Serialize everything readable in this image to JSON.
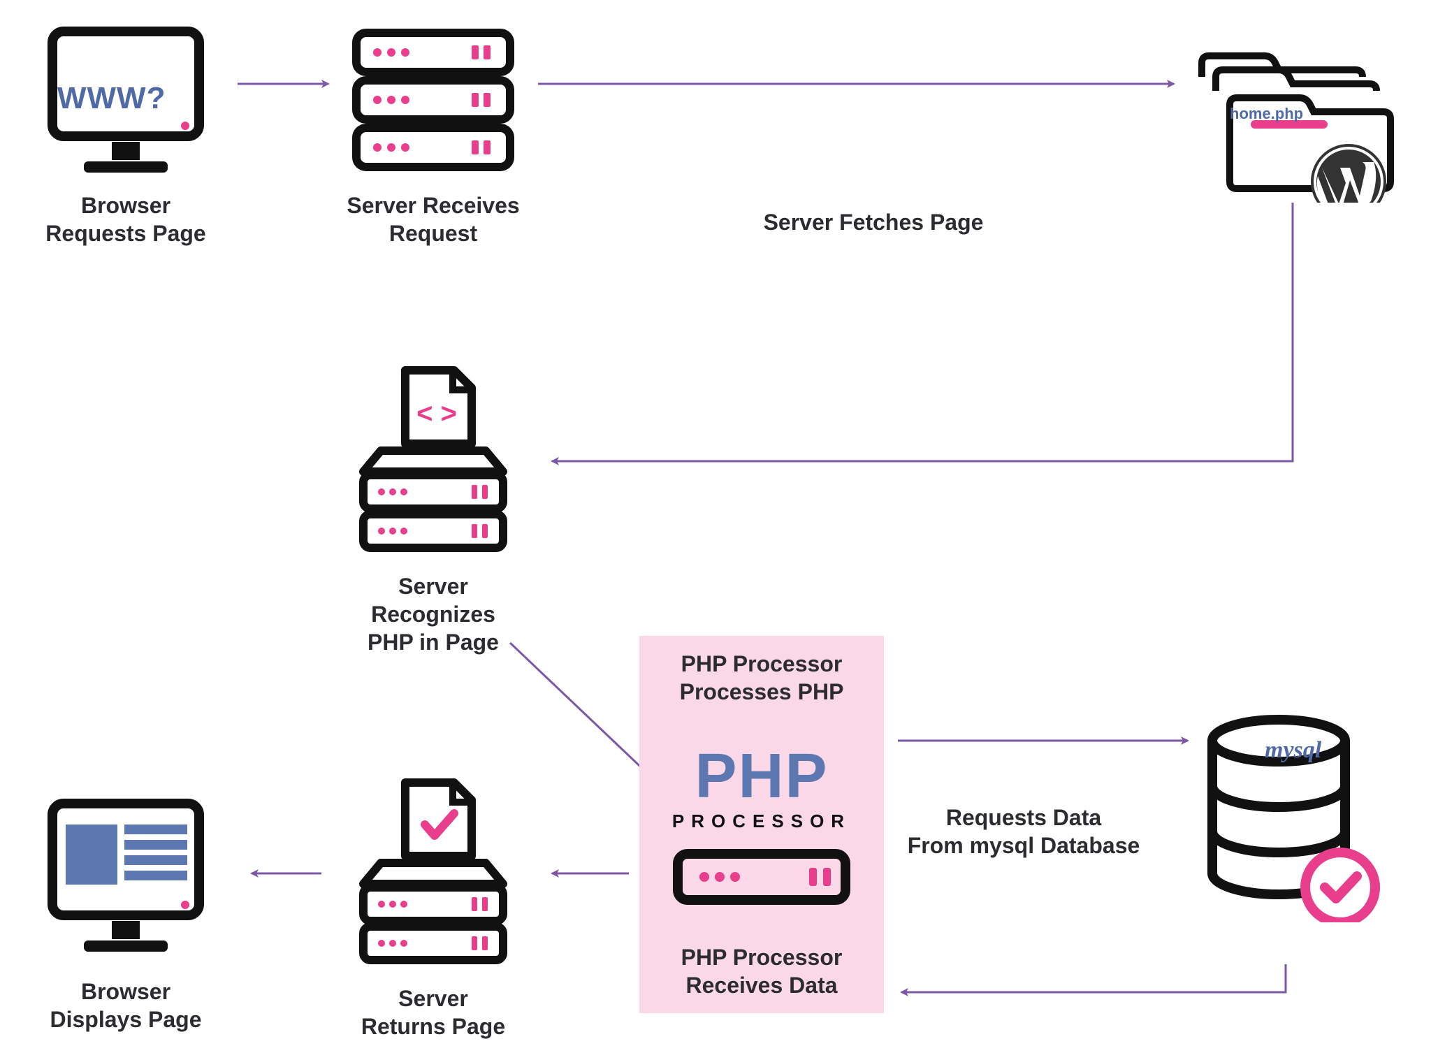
{
  "nodes": {
    "browser_request": "Browser\nRequests Page",
    "server_receives": "Server Receives\nRequest",
    "server_fetches": "Server Fetches Page",
    "folder_file": "home.php",
    "server_recognizes": "Server Recognizes\nPHP in Page",
    "php_top": "PHP Processor\nProcesses PHP",
    "php_big": "PHP",
    "php_sub": "PROCESSOR",
    "php_bot": "PHP Processor\nReceives Data",
    "db_label": "mysql",
    "db_caption": "Requests Data\nFrom mysql Database",
    "www": "WWW?",
    "server_returns": "Server\nReturns Page",
    "browser_displays": "Browser\nDisplays Page"
  },
  "colors": {
    "arrow": "#7b57a6",
    "pink": "#e83e8c",
    "blue": "#5d77b0",
    "phpbg": "#fbd8e7"
  }
}
